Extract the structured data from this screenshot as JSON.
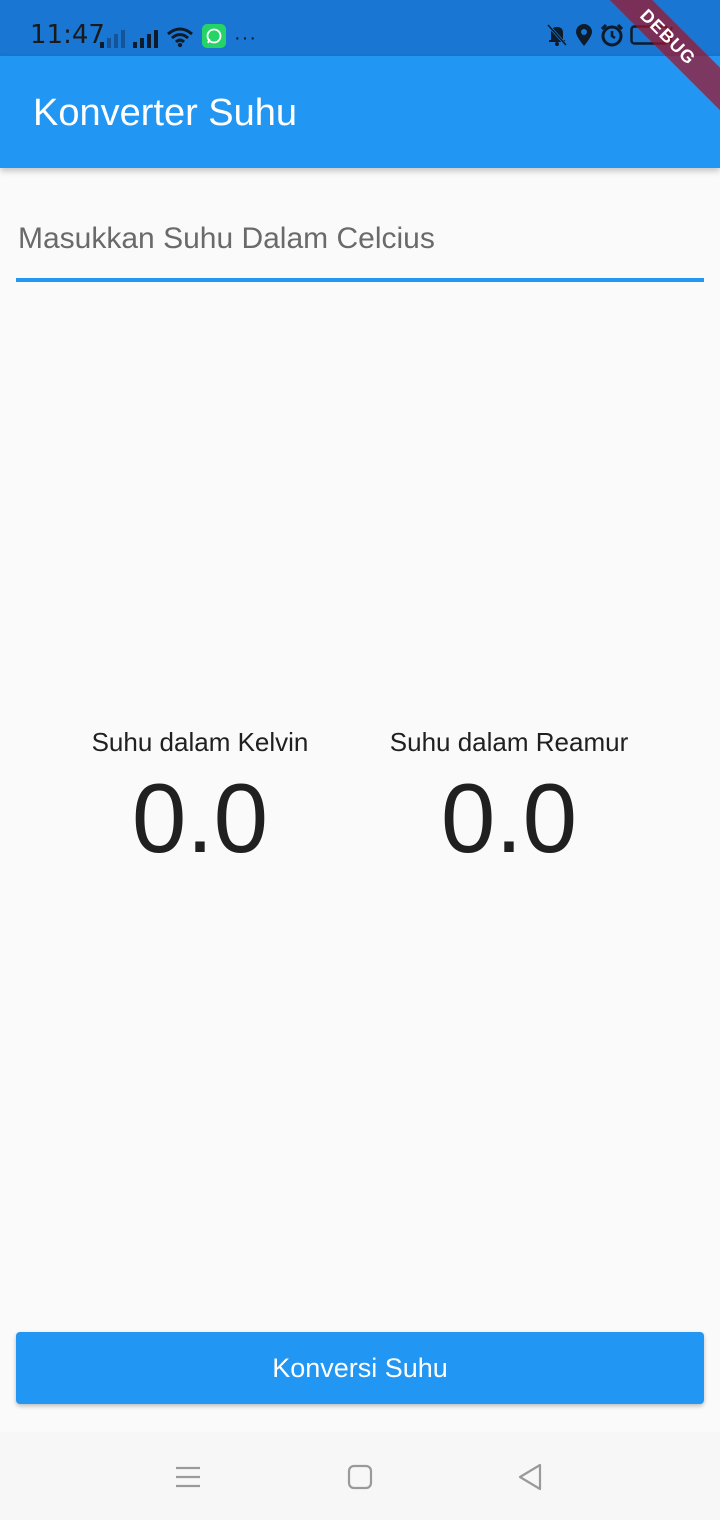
{
  "status_bar": {
    "time": "11:47",
    "icons": [
      "signal-1-icon",
      "signal-2-icon",
      "wifi-icon",
      "whatsapp-icon",
      "more-dots-icon",
      "mute-icon",
      "location-icon",
      "alarm-icon",
      "battery-icon"
    ],
    "more": "···"
  },
  "debug_banner": {
    "label": "DEBUG"
  },
  "app_bar": {
    "title": "Konverter Suhu"
  },
  "input": {
    "placeholder": "Masukkan Suhu Dalam Celcius",
    "value": ""
  },
  "results": {
    "kelvin": {
      "label": "Suhu dalam Kelvin",
      "value": "0.0"
    },
    "reamur": {
      "label": "Suhu dalam Reamur",
      "value": "0.0"
    }
  },
  "button": {
    "label": "Konversi Suhu"
  },
  "nav_bar": {
    "buttons": [
      "menu-icon",
      "home-icon",
      "back-icon"
    ]
  },
  "colors": {
    "primary": "#2196f3",
    "status_bar": "#1976d2",
    "background": "#fafafa"
  }
}
